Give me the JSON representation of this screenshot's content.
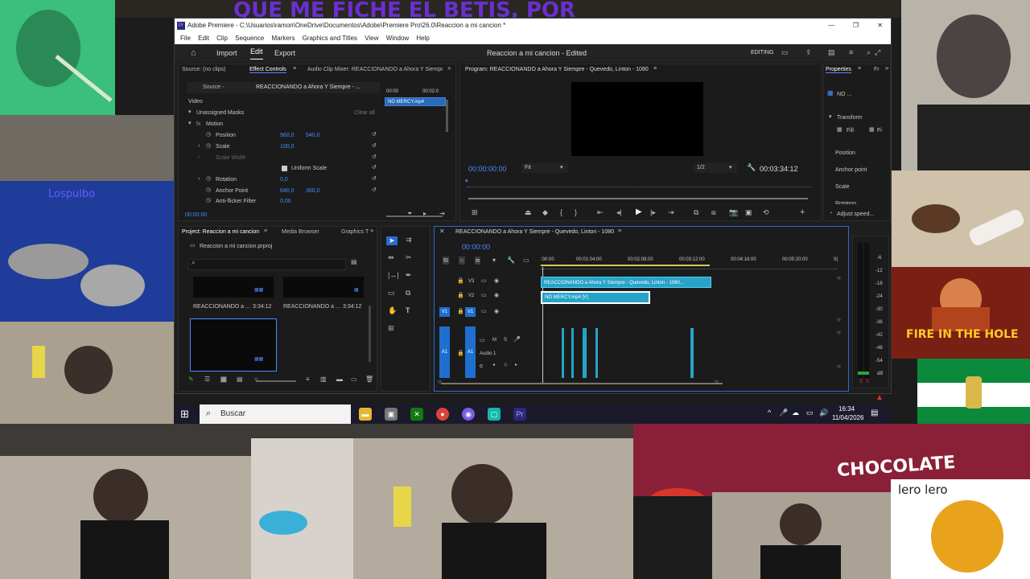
{
  "collage": {
    "top_banner": "QUE ME FICHE EL BETIS, POR",
    "overlay_left": "Lospulbo",
    "fire_text": "FIRE IN THE HOLE",
    "chocolate_text": "CHOCOLATE",
    "lero_text": "lero lero"
  },
  "window": {
    "title": "Adobe Premiere - C:\\Usuarios\\ramon\\OneDrive\\Documentos\\Adobe\\Premiere Pro\\26.0\\Reaccion a mi cancion *",
    "controls": [
      "—",
      "❐",
      "✕"
    ]
  },
  "menu": [
    "File",
    "Edit",
    "Clip",
    "Sequence",
    "Markers",
    "Graphics and Titles",
    "View",
    "Window",
    "Help"
  ],
  "header": {
    "home_icon": "home-icon",
    "tabs": [
      "Import",
      "Edit",
      "Export"
    ],
    "project_title": "Reaccion a mi cancion - Edited",
    "workspace": "EDITING"
  },
  "source_panel": {
    "tabs": [
      "Source: (no clips)",
      "Effect Controls",
      "Audio Clip Mixer: REACCIONANDO a Ahora Y Siempr"
    ],
    "subtabs": [
      "Source -",
      "REACCIONANDO a Ahora Y Siempre - ..."
    ],
    "section": "Video",
    "masks": "Unassigned Masks",
    "clear_all": "Clear all",
    "motion": "Motion",
    "rows": [
      {
        "label": "Position",
        "v1": "960,0",
        "v2": "540,0"
      },
      {
        "label": "Scale",
        "v1": "100,0",
        "v2": ""
      },
      {
        "label": "Scale Width",
        "v1": "",
        "v2": ""
      },
      {
        "label": "Uniform Scale",
        "v1": "",
        "v2": ""
      },
      {
        "label": "Rotation",
        "v1": "0,0",
        "v2": ""
      },
      {
        "label": "Anchor Point",
        "v1": "640,0",
        "v2": "360,0"
      },
      {
        "label": "Anti-flicker Filter",
        "v1": "0,00",
        "v2": ""
      }
    ],
    "mini_timecodes": [
      "00:00",
      "00:02:0"
    ],
    "mini_clip": "NO MERCY.mp4",
    "timecode": "00:00:00"
  },
  "program_panel": {
    "tab": "Program: REACCIONANDO a Ahora Y Siempre - Quevedo, Linton - 1080",
    "timecode": "00:00:00:00",
    "fit": "Fit",
    "resolution": "1/2",
    "duration": "00:03:34:12"
  },
  "properties_panel": {
    "tab": "Properties",
    "tab2": "Fr",
    "clip_name": "NO ...",
    "transform": "Transform",
    "fill": "Fill",
    "fi": "Fi",
    "items": [
      "Position",
      "Anchor point",
      "Scale",
      "Rotation"
    ],
    "adjust": "Adjust speed..."
  },
  "project_panel": {
    "tabs": [
      "Project: Reaccion a mi cancion",
      "Media Browser",
      "Graphics T"
    ],
    "file": "Reaccion a mi cancion.prproj",
    "items": [
      {
        "name": "REACCIONANDO a ...",
        "duration": "3:34:12"
      },
      {
        "name": "REACCIONANDO a ...",
        "duration": "3:34:12"
      }
    ]
  },
  "timeline": {
    "tab": "REACCIONANDO a Ahora Y Siempre - Quevedo, Linton - 1080",
    "timecode": "00:00:00",
    "ruler": [
      ":00:00",
      "00:01:04:00",
      "00:02:08:00",
      "00:03:12:00",
      "00:04:16:00",
      "00:05:20:00",
      "0("
    ],
    "tracks": [
      "V3",
      "V2",
      "V1",
      "A1"
    ],
    "audio_name": "Audio 1",
    "clip_v3": "REACCIONANDO a Ahora Y Siempre - Quevedo, Linton - 1080...",
    "clip_v2": "NO MERCY.mp4 [V]"
  },
  "meter": {
    "labels": [
      "-6",
      "-12",
      "-18",
      "-24",
      "-30",
      "-36",
      "-42",
      "-48",
      "-54",
      "dB"
    ],
    "bottom": [
      "S",
      "S"
    ]
  },
  "taskbar": {
    "search": "Buscar",
    "time": "16:34",
    "date": "11/04/2026"
  },
  "colors": {
    "accent": "#4a8cff",
    "clip": "#27a3c9",
    "track": "#1f6fd1"
  }
}
